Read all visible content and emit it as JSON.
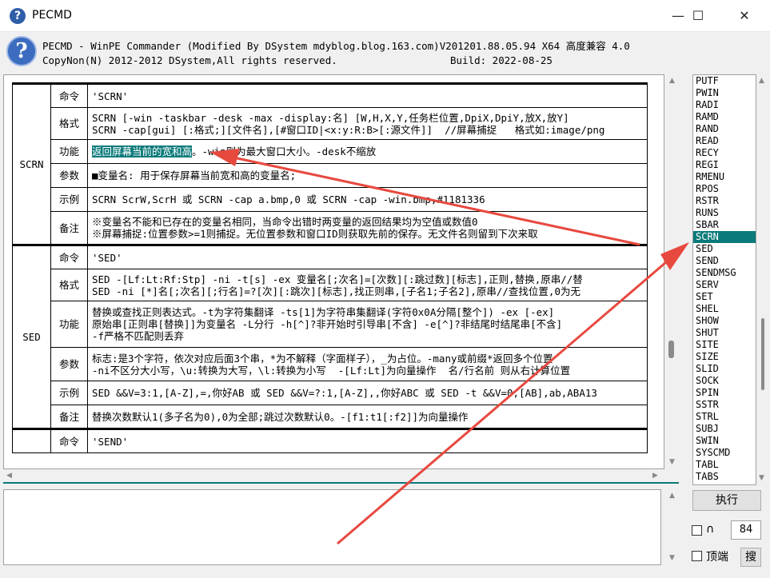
{
  "window": {
    "title": "PECMD",
    "minimize": "—",
    "maximize": "☐",
    "close": "✕"
  },
  "header": {
    "line1": "PECMD - WinPE Commander (Modified By DSystem mdyblog.blog.163.com)V201201.88.05.94 X64 高度兼容 4.0",
    "line2": "CopyNon(N) 2012-2012 DSystem,All rights reserved.",
    "build": "Build:  2022-08-25"
  },
  "doc": {
    "scrn": {
      "name": "SCRN",
      "rows": [
        {
          "key": "命令",
          "val": "'SCRN'"
        },
        {
          "key": "格式",
          "val": "SCRN [-win -taskbar -desk -max -display:名] [W,H,X,Y,任务栏位置,DpiX,DpiY,放X,放Y]\nSCRN -cap[gui] [:格式;][文件名],[#窗口ID|<x:y:R:B>[:源文件]]  //屏幕捕捉   格式如:image/png"
        },
        {
          "key": "功能",
          "val_hl": "返回屏幕当前的宽和高",
          "val": "。-win则为最大窗口大小。-desk不缩放"
        },
        {
          "key": "参数",
          "val": "■变量名: 用于保存屏幕当前宽和高的变量名;"
        },
        {
          "key": "示例",
          "val": "SCRN ScrW,ScrH  或  SCRN -cap  a.bmp,0   或   SCRN -cap -win.bmp,#1181336"
        },
        {
          "key": "备注",
          "val": "※变量名不能和已存在的变量名相同，当命令出错时两变量的返回结果均为空值或数值0\n※屏幕捕捉:位置参数>=1则捕捉。无位置参数和窗口ID则获取先前的保存。无文件名则留到下次来取"
        }
      ]
    },
    "sed": {
      "name": "SED",
      "rows": [
        {
          "key": "命令",
          "val": "'SED'"
        },
        {
          "key": "格式",
          "val": "SED -[Lf:Lt:Rf:Stp] -ni -t[s] -ex 变量名[;次名]=[次数][:跳过数][标志],正则,替换,原串//替\nSED -ni [*]名[;次名][;行名]=?[次][:跳次][标志],找正则串,[子名1;子名2],原串//查找位置,0为无"
        },
        {
          "key": "功能",
          "val": "替换或查找正则表达式。-t为字符集翻译 -ts[1]为字符串集翻译(字符0x0A分隔[整个]) -ex [-ex]\n原始串[正则串[替换]]为变量名 -L分行 -h[^]?非开始时引导串[不含] -e[^]?非结尾时结尾串[不含]\n-f严格不匹配则丢弃"
        },
        {
          "key": "参数",
          "val": "标志:是3个字符，依次对应后面3个串，*为不解释（字面样子），_为占位。-many或前缀*返回多个位置\n-ni不区分大小写，\\u:转换为大写，\\l:转换为小写  -[Lf:Lt]为向量操作  名/行名前 则从右计算位置"
        },
        {
          "key": "示例",
          "val": "SED &&V=3:1,[A-Z],=,你好AB 或 SED &&V=?:1,[A-Z],,你好ABC 或 SED -t &&V=0,[AB],ab,ABA13"
        },
        {
          "key": "备注",
          "val": "替换次数默认1(多子名为0),0为全部;跳过次数默认0。-[f1:t1[:f2]]为向量操作"
        }
      ]
    },
    "send": {
      "key": "命令",
      "val": "'SEND'"
    }
  },
  "command_list": {
    "items": [
      "PUTF",
      "PWIN",
      "RADI",
      "RAMD",
      "RAND",
      "READ",
      "RECY",
      "REGI",
      "RMENU",
      "RPOS",
      "RSTR",
      "RUNS",
      "SBAR",
      "SCRN",
      "SED",
      "SEND",
      "SENDMSG",
      "SERV",
      "SET",
      "SHEL",
      "SHOW",
      "SHUT",
      "SITE",
      "SIZE",
      "SLID",
      "SOCK",
      "SPIN",
      "SSTR",
      "STRL",
      "SUBJ",
      "SWIN",
      "SYSCMD",
      "TABL",
      "TABS"
    ],
    "selected": "SCRN"
  },
  "controls": {
    "execute_label": "执行",
    "checkbox1_label": "∩",
    "number_value": "84",
    "checkbox2_label": "顶端",
    "search_label": "搜"
  },
  "colors": {
    "accent": "#0b7a7a",
    "arrow": "#e8493f"
  }
}
